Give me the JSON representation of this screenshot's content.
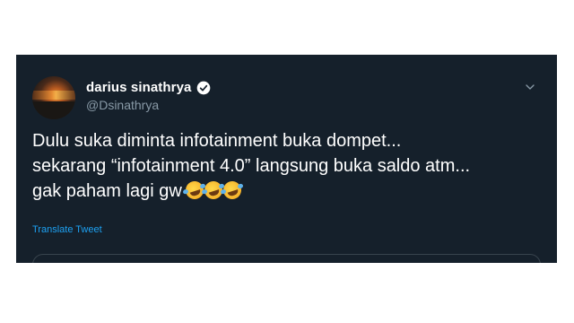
{
  "tweet": {
    "display_name": "darius sinathrya",
    "handle": "@Dsinathrya",
    "text_lines": [
      "Dulu suka diminta infotainment buka dompet...",
      "sekarang “infotainment 4.0” langsung buka saldo atm...",
      "gak paham lagi gw"
    ],
    "emoji": [
      "rolling-on-floor-laughing",
      "rolling-on-floor-laughing",
      "rolling-on-floor-laughing"
    ],
    "translate_label": "Translate Tweet",
    "verified": true
  },
  "colors": {
    "background": "#15202b",
    "text": "#ffffff",
    "secondary_text": "#8899a6",
    "link": "#1da1f2",
    "border": "#38444d"
  }
}
